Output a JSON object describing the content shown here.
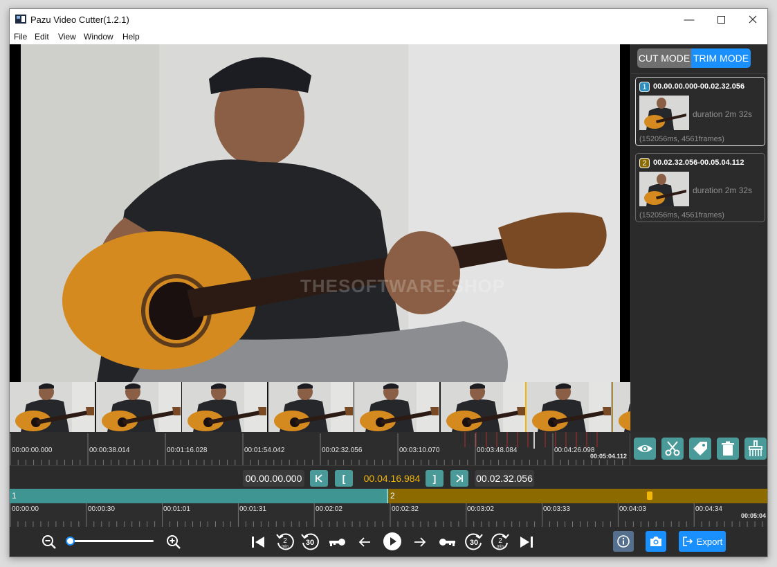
{
  "window": {
    "title": "Pazu Video Cutter(1.2.1)",
    "controls": [
      "minimize-icon",
      "maximize-icon",
      "close-icon"
    ]
  },
  "menu": [
    "File",
    "Edit",
    "View",
    "Window",
    "Help"
  ],
  "video": {
    "watermark": "THESOFTWARE.SHOP"
  },
  "mode": {
    "cut_label": "CUT MODE",
    "trim_label": "TRIM MODE",
    "active": "TRIM MODE",
    "colors": {
      "active": "#1a90ff",
      "inactive": "#707070"
    }
  },
  "segments": [
    {
      "number": "1",
      "range": "00.00.00.000-00.02.32.056",
      "duration": "duration 2m 32s",
      "details": "(152056ms, 4561frames)",
      "color": "#2e8ec0"
    },
    {
      "number": "2",
      "range": "00.02.32.056-00.05.04.112",
      "duration": "duration 2m 32s",
      "details": "(152056ms, 4561frames)",
      "color": "#8c6a00"
    }
  ],
  "filmstrip_timeline": {
    "labels": [
      "00:00:00.000",
      "00:00:38.014",
      "00:01:16.028",
      "00:01:54.042",
      "00:02:32.056",
      "00:03:10.070",
      "00:03:48.084",
      "00:04:26.098",
      "00:05:04.112"
    ]
  },
  "tools": [
    "eye-icon",
    "scissors-icon",
    "tag-icon",
    "trash-icon",
    "broom-icon"
  ],
  "time_controls": {
    "start": "00.00.00.000",
    "current": "00.04.16.984",
    "end": "00.02.32.056",
    "go_start_label": "K",
    "mark_in_label": "[",
    "mark_out_label": "]",
    "go_end_label": "K",
    "current_color": "#f2b705"
  },
  "segment_bar": {
    "segment1_label": "1",
    "segment2_label": "2",
    "colors": {
      "segment1": "#3f9592",
      "segment2": "#8c6a00"
    }
  },
  "main_timeline": {
    "labels": [
      "00:00:00",
      "00:00:30",
      "00:01:01",
      "00:01:31",
      "00:02:02",
      "00:02:32",
      "00:03:02",
      "00:03:33",
      "00:04:03",
      "00:04:34",
      "00:05:04"
    ]
  },
  "playback": {
    "zoom_level": 0,
    "export_label": "Export"
  }
}
